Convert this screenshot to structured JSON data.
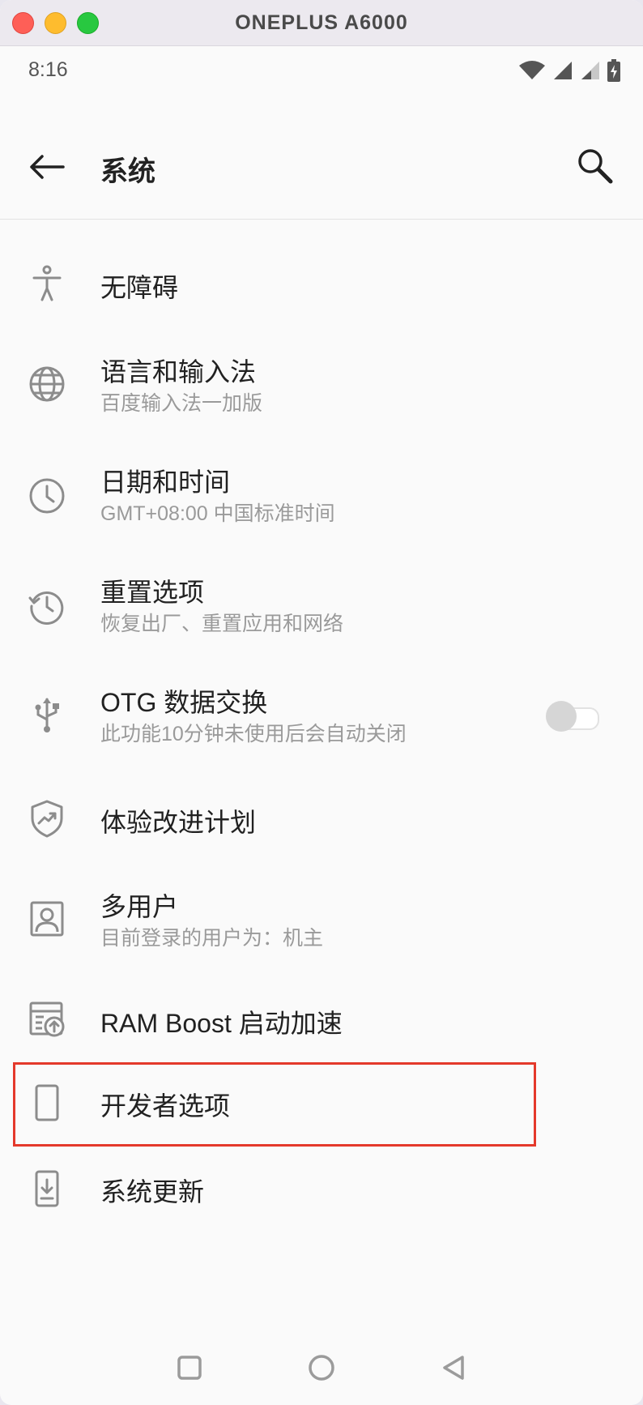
{
  "window": {
    "title": "ONEPLUS A6000"
  },
  "status_bar": {
    "time": "8:16",
    "icons": [
      "wifi-icon",
      "signal-icon",
      "signal-weak-icon",
      "battery-charging-icon"
    ]
  },
  "app_bar": {
    "title": "系统",
    "back_icon": "back-arrow-icon",
    "search_icon": "search-icon"
  },
  "settings": [
    {
      "icon": "accessibility-icon",
      "label": "无障碍",
      "sub": ""
    },
    {
      "icon": "globe-icon",
      "label": "语言和输入法",
      "sub": "百度输入法一加版"
    },
    {
      "icon": "clock-icon",
      "label": "日期和时间",
      "sub": "GMT+08:00 中国标准时间"
    },
    {
      "icon": "history-reset-icon",
      "label": "重置选项",
      "sub": "恢复出厂、重置应用和网络"
    },
    {
      "icon": "usb-icon",
      "label": "OTG 数据交换",
      "sub": "此功能10分钟未使用后会自动关闭",
      "toggle": false
    },
    {
      "icon": "shield-trend-icon",
      "label": "体验改进计划",
      "sub": ""
    },
    {
      "icon": "user-icon",
      "label": "多用户",
      "sub": "目前登录的用户为：机主"
    },
    {
      "icon": "ram-boost-icon",
      "label": "RAM Boost 启动加速",
      "sub": ""
    },
    {
      "icon": "phone-outline-icon",
      "label": "开发者选项",
      "sub": "",
      "highlighted": true
    },
    {
      "icon": "system-update-icon",
      "label": "系统更新",
      "sub": ""
    }
  ],
  "nav_bar": {
    "icons": [
      "recents-square-icon",
      "home-circle-icon",
      "back-triangle-icon"
    ]
  },
  "colors": {
    "highlight_border": "#e4392b",
    "icon_gray": "#8c8c8c",
    "text_primary": "#212121",
    "text_secondary": "#9a9a9a"
  }
}
